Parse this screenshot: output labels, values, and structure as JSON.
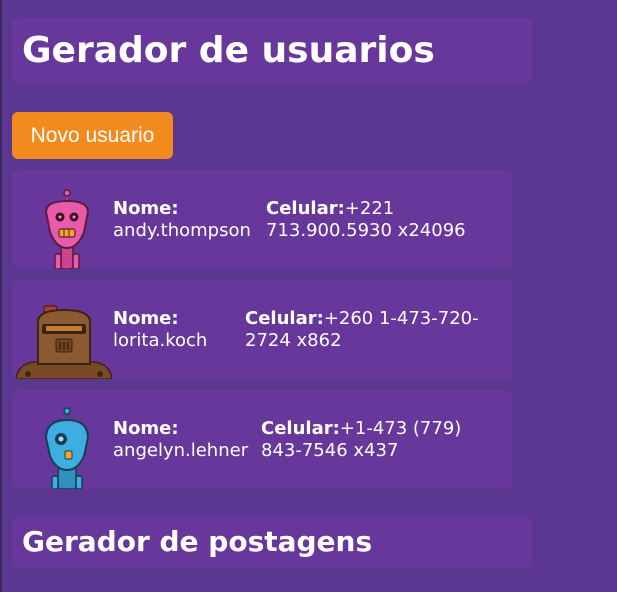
{
  "users_section": {
    "title": "Gerador de usuarios",
    "new_user_button": "Novo usuario"
  },
  "users": [
    {
      "name_label": "Nome:",
      "name": "andy.thompson",
      "phone_label": "Celular:",
      "phone_line1": "+221",
      "phone_line2": "713.900.5930 x24096",
      "avatar_icon": "pink-robot-avatar-icon",
      "avatar_color": "#e95aa8"
    },
    {
      "name_label": "Nome:",
      "name": "lorita.koch",
      "phone_label": "Celular:",
      "phone_line1": "+260 1-473-720-",
      "phone_line2": "2724 x862",
      "avatar_icon": "brown-robot-avatar-icon",
      "avatar_color": "#8b5a33"
    },
    {
      "name_label": "Nome:",
      "name": "angelyn.lehner",
      "phone_label": "Celular:",
      "phone_line1": "+1-473 (779)",
      "phone_line2": "843-7546 x437",
      "avatar_icon": "blue-robot-avatar-icon",
      "avatar_color": "#3eaee0"
    }
  ],
  "posts_section": {
    "title": "Gerador de postagens"
  },
  "colors": {
    "background": "#5b3791",
    "panel": "#68379c",
    "button": "#f38a1e",
    "text": "#ffffff"
  }
}
